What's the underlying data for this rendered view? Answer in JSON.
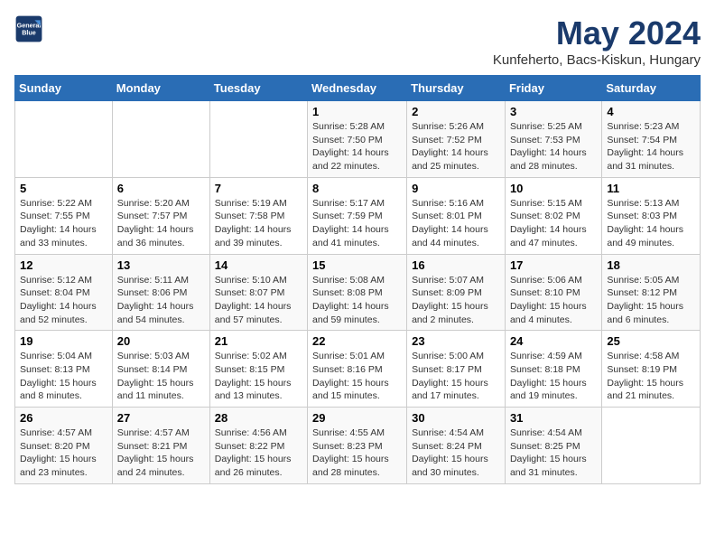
{
  "header": {
    "logo_line1": "General",
    "logo_line2": "Blue",
    "title": "May 2024",
    "subtitle": "Kunfeherto, Bacs-Kiskun, Hungary"
  },
  "weekdays": [
    "Sunday",
    "Monday",
    "Tuesday",
    "Wednesday",
    "Thursday",
    "Friday",
    "Saturday"
  ],
  "weeks": [
    [
      {
        "day": "",
        "info": ""
      },
      {
        "day": "",
        "info": ""
      },
      {
        "day": "",
        "info": ""
      },
      {
        "day": "1",
        "info": "Sunrise: 5:28 AM\nSunset: 7:50 PM\nDaylight: 14 hours\nand 22 minutes."
      },
      {
        "day": "2",
        "info": "Sunrise: 5:26 AM\nSunset: 7:52 PM\nDaylight: 14 hours\nand 25 minutes."
      },
      {
        "day": "3",
        "info": "Sunrise: 5:25 AM\nSunset: 7:53 PM\nDaylight: 14 hours\nand 28 minutes."
      },
      {
        "day": "4",
        "info": "Sunrise: 5:23 AM\nSunset: 7:54 PM\nDaylight: 14 hours\nand 31 minutes."
      }
    ],
    [
      {
        "day": "5",
        "info": "Sunrise: 5:22 AM\nSunset: 7:55 PM\nDaylight: 14 hours\nand 33 minutes."
      },
      {
        "day": "6",
        "info": "Sunrise: 5:20 AM\nSunset: 7:57 PM\nDaylight: 14 hours\nand 36 minutes."
      },
      {
        "day": "7",
        "info": "Sunrise: 5:19 AM\nSunset: 7:58 PM\nDaylight: 14 hours\nand 39 minutes."
      },
      {
        "day": "8",
        "info": "Sunrise: 5:17 AM\nSunset: 7:59 PM\nDaylight: 14 hours\nand 41 minutes."
      },
      {
        "day": "9",
        "info": "Sunrise: 5:16 AM\nSunset: 8:01 PM\nDaylight: 14 hours\nand 44 minutes."
      },
      {
        "day": "10",
        "info": "Sunrise: 5:15 AM\nSunset: 8:02 PM\nDaylight: 14 hours\nand 47 minutes."
      },
      {
        "day": "11",
        "info": "Sunrise: 5:13 AM\nSunset: 8:03 PM\nDaylight: 14 hours\nand 49 minutes."
      }
    ],
    [
      {
        "day": "12",
        "info": "Sunrise: 5:12 AM\nSunset: 8:04 PM\nDaylight: 14 hours\nand 52 minutes."
      },
      {
        "day": "13",
        "info": "Sunrise: 5:11 AM\nSunset: 8:06 PM\nDaylight: 14 hours\nand 54 minutes."
      },
      {
        "day": "14",
        "info": "Sunrise: 5:10 AM\nSunset: 8:07 PM\nDaylight: 14 hours\nand 57 minutes."
      },
      {
        "day": "15",
        "info": "Sunrise: 5:08 AM\nSunset: 8:08 PM\nDaylight: 14 hours\nand 59 minutes."
      },
      {
        "day": "16",
        "info": "Sunrise: 5:07 AM\nSunset: 8:09 PM\nDaylight: 15 hours\nand 2 minutes."
      },
      {
        "day": "17",
        "info": "Sunrise: 5:06 AM\nSunset: 8:10 PM\nDaylight: 15 hours\nand 4 minutes."
      },
      {
        "day": "18",
        "info": "Sunrise: 5:05 AM\nSunset: 8:12 PM\nDaylight: 15 hours\nand 6 minutes."
      }
    ],
    [
      {
        "day": "19",
        "info": "Sunrise: 5:04 AM\nSunset: 8:13 PM\nDaylight: 15 hours\nand 8 minutes."
      },
      {
        "day": "20",
        "info": "Sunrise: 5:03 AM\nSunset: 8:14 PM\nDaylight: 15 hours\nand 11 minutes."
      },
      {
        "day": "21",
        "info": "Sunrise: 5:02 AM\nSunset: 8:15 PM\nDaylight: 15 hours\nand 13 minutes."
      },
      {
        "day": "22",
        "info": "Sunrise: 5:01 AM\nSunset: 8:16 PM\nDaylight: 15 hours\nand 15 minutes."
      },
      {
        "day": "23",
        "info": "Sunrise: 5:00 AM\nSunset: 8:17 PM\nDaylight: 15 hours\nand 17 minutes."
      },
      {
        "day": "24",
        "info": "Sunrise: 4:59 AM\nSunset: 8:18 PM\nDaylight: 15 hours\nand 19 minutes."
      },
      {
        "day": "25",
        "info": "Sunrise: 4:58 AM\nSunset: 8:19 PM\nDaylight: 15 hours\nand 21 minutes."
      }
    ],
    [
      {
        "day": "26",
        "info": "Sunrise: 4:57 AM\nSunset: 8:20 PM\nDaylight: 15 hours\nand 23 minutes."
      },
      {
        "day": "27",
        "info": "Sunrise: 4:57 AM\nSunset: 8:21 PM\nDaylight: 15 hours\nand 24 minutes."
      },
      {
        "day": "28",
        "info": "Sunrise: 4:56 AM\nSunset: 8:22 PM\nDaylight: 15 hours\nand 26 minutes."
      },
      {
        "day": "29",
        "info": "Sunrise: 4:55 AM\nSunset: 8:23 PM\nDaylight: 15 hours\nand 28 minutes."
      },
      {
        "day": "30",
        "info": "Sunrise: 4:54 AM\nSunset: 8:24 PM\nDaylight: 15 hours\nand 30 minutes."
      },
      {
        "day": "31",
        "info": "Sunrise: 4:54 AM\nSunset: 8:25 PM\nDaylight: 15 hours\nand 31 minutes."
      },
      {
        "day": "",
        "info": ""
      }
    ]
  ]
}
